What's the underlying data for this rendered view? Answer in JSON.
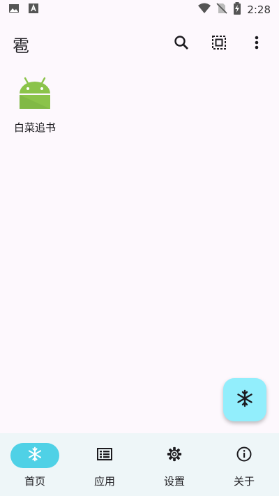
{
  "status_bar": {
    "time": "2:28",
    "icons": [
      "image-icon",
      "font-icon",
      "wifi-icon",
      "no-sim-icon",
      "battery-charging-icon"
    ]
  },
  "app_bar": {
    "title": "雹",
    "actions": [
      "search-icon",
      "select-all-icon",
      "more-vert-icon"
    ]
  },
  "apps": [
    {
      "label": "白菜追书",
      "icon": "android-icon"
    }
  ],
  "fab": {
    "icon": "snowflake-icon",
    "color": "#92eefc"
  },
  "bottom_nav": {
    "items": [
      {
        "label": "首页",
        "icon": "snowflake-icon",
        "active": true
      },
      {
        "label": "应用",
        "icon": "list-icon",
        "active": false
      },
      {
        "label": "设置",
        "icon": "gear-icon",
        "active": false
      },
      {
        "label": "关于",
        "icon": "info-icon",
        "active": false
      }
    ]
  },
  "colors": {
    "background": "#fdf8fd",
    "nav_background": "#eef6f8",
    "active_pill": "#4fd1e6",
    "android_green": "#8bc34a"
  }
}
